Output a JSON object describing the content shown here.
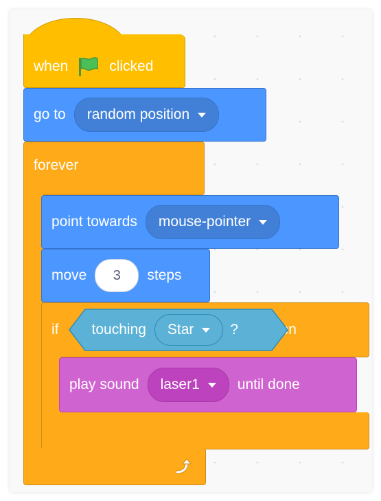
{
  "script": {
    "hat": {
      "text_before": "when",
      "icon": "green-flag-icon",
      "text_after": "clicked"
    },
    "goto": {
      "label": "go to",
      "dropdown": "random position"
    },
    "forever": {
      "label": "forever",
      "loop_icon": "loop-arrow-icon"
    },
    "point": {
      "label": "point towards",
      "dropdown": "mouse-pointer"
    },
    "move": {
      "label": "move",
      "value": "3",
      "unit": "steps"
    },
    "if": {
      "label": "if",
      "then": "then"
    },
    "touching": {
      "label": "touching",
      "dropdown": "Star",
      "question": "?"
    },
    "sound": {
      "label": "play sound",
      "dropdown": "laser1",
      "suffix": "until done"
    }
  },
  "colors": {
    "events": "#ffbf00",
    "motion": "#4c97ff",
    "control": "#ffab19",
    "sensing": "#5cb1d6",
    "sound": "#cf63cf"
  }
}
